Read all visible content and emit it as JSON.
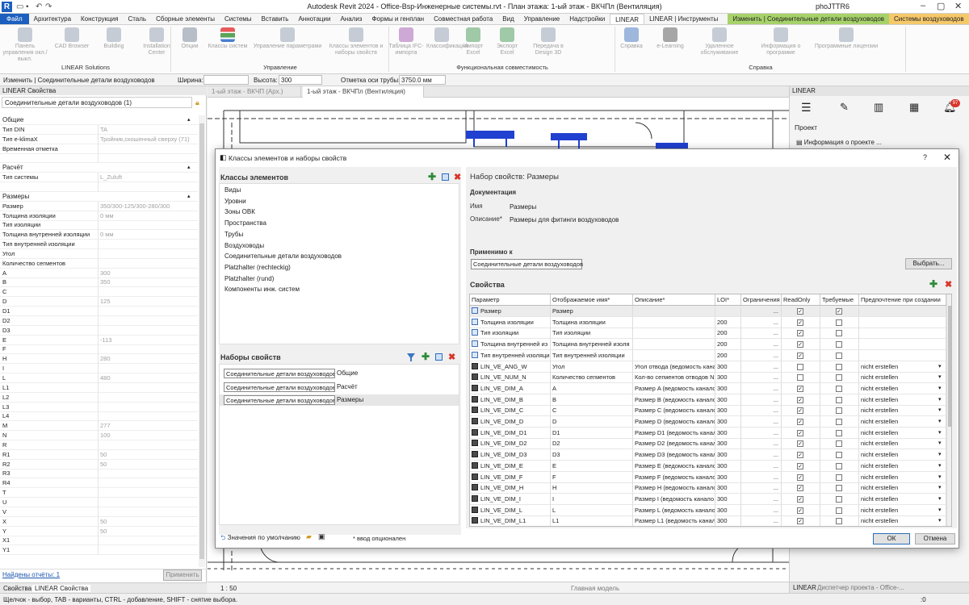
{
  "titlebar": {
    "app_title": "Autodesk Revit 2024 - Office-Bsp-Инженерные системы.rvt - План этажа: 1-ый этаж - ВКЧПл (Вентиляция)",
    "user": "phoJTTR6",
    "logo": "R"
  },
  "tabs": [
    "Файл",
    "Архитектура",
    "Конструкция",
    "Сталь",
    "Сборные элементы",
    "Системы",
    "Вставить",
    "Аннотации",
    "Анализ",
    "Формы и генплан",
    "Совместная работа",
    "Вид",
    "Управление",
    "Надстройки",
    "LINEAR",
    "LINEAR | Инструменты",
    "Изменить | Соединительные детали воздуховодов",
    "Системы воздуховодов"
  ],
  "ribbon": {
    "buttons": [
      "Панель управления окл./выкл.",
      "CAD Browser",
      "Building",
      "Installation Center",
      "Опции",
      "Классы систем",
      "Управление параметрами",
      "Классы элементов и наборы свойств",
      "Таблица IFC-импорта",
      "Классификация",
      "Импорт Excel",
      "Экспорт Excel",
      "Передача в Design 3D",
      "Справка",
      "e-Learning",
      "Удаленное обслуживание",
      "Информация о программе",
      "Программные лицензии"
    ],
    "groups": [
      "LINEAR Solutions",
      "Управление",
      "Функциональная совместимость",
      "Справка"
    ]
  },
  "optbar": {
    "modify_label": "Изменить | Соединительные детали воздуховодов",
    "width_label": "Ширина:",
    "height_label": "Высота:",
    "height_value": "300",
    "pipe_axis_label": "Отметка оси трубы:",
    "pipe_axis_value": "3750.0 мм"
  },
  "props": {
    "header": "LINEAR Свойства",
    "type_selector": "Соединительные детали воздуховодов (1)",
    "rows": [
      {
        "k": "Общие",
        "v": "",
        "sec": true
      },
      {
        "k": "Тип DIN",
        "v": "TA"
      },
      {
        "k": "Тип e-klimaX",
        "v": "Тройник,скошенный сверху (71)"
      },
      {
        "k": "Временная отметка",
        "v": ""
      },
      {
        "k": "",
        "v": ""
      },
      {
        "k": "Расчёт",
        "v": "",
        "sec": true
      },
      {
        "k": "Тип системы",
        "v": "L_Zuluft"
      },
      {
        "k": "",
        "v": ""
      },
      {
        "k": "Размеры",
        "v": "",
        "sec": true
      },
      {
        "k": "Размер",
        "v": "350/300-125/300-280/300"
      },
      {
        "k": "Толщина изоляции",
        "v": "0 мм"
      },
      {
        "k": "Тип изоляции",
        "v": ""
      },
      {
        "k": "Толщина внутренней изоляции",
        "v": "0 мм"
      },
      {
        "k": "Тип внутренней изоляции",
        "v": ""
      },
      {
        "k": "Угол",
        "v": ""
      },
      {
        "k": "Количество сегментов",
        "v": ""
      },
      {
        "k": "A",
        "v": "300"
      },
      {
        "k": "B",
        "v": "350"
      },
      {
        "k": "C",
        "v": ""
      },
      {
        "k": "D",
        "v": "125"
      },
      {
        "k": "D1",
        "v": ""
      },
      {
        "k": "D2",
        "v": ""
      },
      {
        "k": "D3",
        "v": ""
      },
      {
        "k": "E",
        "v": "-113"
      },
      {
        "k": "F",
        "v": ""
      },
      {
        "k": "H",
        "v": "280"
      },
      {
        "k": "I",
        "v": ""
      },
      {
        "k": "L",
        "v": "480"
      },
      {
        "k": "L1",
        "v": ""
      },
      {
        "k": "L2",
        "v": ""
      },
      {
        "k": "L3",
        "v": ""
      },
      {
        "k": "L4",
        "v": ""
      },
      {
        "k": "M",
        "v": "277"
      },
      {
        "k": "N",
        "v": "100"
      },
      {
        "k": "R",
        "v": ""
      },
      {
        "k": "R1",
        "v": "50"
      },
      {
        "k": "R2",
        "v": "50"
      },
      {
        "k": "R3",
        "v": ""
      },
      {
        "k": "R4",
        "v": ""
      },
      {
        "k": "T",
        "v": ""
      },
      {
        "k": "U",
        "v": ""
      },
      {
        "k": "V",
        "v": ""
      },
      {
        "k": "X",
        "v": "50"
      },
      {
        "k": "Y",
        "v": "50"
      },
      {
        "k": "X1",
        "v": ""
      },
      {
        "k": "Y1",
        "v": ""
      }
    ],
    "found_reports": "Найдены отчёты: 1",
    "apply_button": "Применить",
    "bottom_tabs": [
      "Свойства",
      "LINEAR Свойства"
    ]
  },
  "view": {
    "tabs": [
      "1-ый этаж - ВКЧП (Арх.)",
      "1-ый этаж - ВКЧПл (Вентиляция)"
    ],
    "scale": "1 : 50",
    "main_model": "Главная модель"
  },
  "linear_panel": {
    "header": "LINEAR",
    "badge": "97",
    "section": "Проект",
    "project_info": "Информация о проекте ...",
    "bottom_tabs": [
      "LINEAR",
      "Диспетчер проекта - Office-..."
    ]
  },
  "status": {
    "hint": "Щелчок - выбор, TAB - варианты, CTRL - добавление, SHIFT - снятие выбора.",
    "zoom": ":0"
  },
  "dialog": {
    "title": "Классы элементов и наборы свойств",
    "help": "?",
    "classes_label": "Классы элементов",
    "classes": [
      "Виды",
      "Уровни",
      "Зоны ОВК",
      "Пространства",
      "Трубы",
      "Воздуховоды",
      "Соединительные детали воздуховодов",
      "Platzhalter (rechteckig)",
      "Platzhalter (rund)",
      "Компоненты инж. систем"
    ],
    "sets_label": "Наборы свойств",
    "sets": [
      {
        "class": "Соединительные детали воздуховодов",
        "name": "Общие"
      },
      {
        "class": "Соединительные детали воздуховодов",
        "name": "Расчёт"
      },
      {
        "class": "Соединительные детали воздуховодов",
        "name": "Размеры"
      }
    ],
    "defaults_label": "Значения по умолчанию",
    "optional_note": "* ввод опционален",
    "set_title": "Набор свойств: Размеры",
    "documentation_label": "Документация",
    "name_label": "Имя",
    "name_value": "Размеры",
    "desc_label": "Описание*",
    "desc_value": "Размеры для фитинги воздуховодов",
    "applies_label": "Применимо к",
    "applies_value": "Соединительные детали воздуховодов",
    "choose_button": "Выбрать...",
    "properties_label": "Свойства",
    "ok": "ОК",
    "cancel": "Отмена",
    "columns": [
      "Параметр",
      "Отображаемое имя*",
      "Описание*",
      "LOI*",
      "Ограничения",
      "ReadOnly",
      "Требуемые",
      "Предпочтение при создании"
    ],
    "rows": [
      {
        "p": "Размер",
        "d": "Размер",
        "desc": "",
        "loi": "",
        "ro": true,
        "req": true,
        "pref": "",
        "icon": "b"
      },
      {
        "p": "Толщина изоляции",
        "d": "Толщина изоляции",
        "desc": "",
        "loi": "200",
        "ro": true,
        "req": false,
        "pref": "",
        "icon": "b"
      },
      {
        "p": "Тип изоляции",
        "d": "Тип изоляции",
        "desc": "",
        "loi": "200",
        "ro": true,
        "req": false,
        "pref": "",
        "icon": "b"
      },
      {
        "p": "Толщина внутренней из",
        "d": "Толщина внутренней изоля",
        "desc": "",
        "loi": "200",
        "ro": true,
        "req": false,
        "pref": "",
        "icon": "b"
      },
      {
        "p": "Тип внутренней изоляци",
        "d": "Тип внутренней изоляции",
        "desc": "",
        "loi": "200",
        "ro": true,
        "req": false,
        "pref": "",
        "icon": "b"
      },
      {
        "p": "LIN_VE_ANG_W",
        "d": "Угол",
        "desc": "Угол отвода (ведомость кана",
        "loi": "300",
        "ro": false,
        "req": false,
        "pref": "nicht erstellen",
        "icon": "d"
      },
      {
        "p": "LIN_VE_NUM_N",
        "d": "Количество сегментов",
        "desc": "Кол-во сегментов отводов N",
        "loi": "300",
        "ro": false,
        "req": false,
        "pref": "nicht erstellen",
        "icon": "d"
      },
      {
        "p": "LIN_VE_DIM_A",
        "d": "A",
        "desc": "Размер A (ведомость канало",
        "loi": "300",
        "ro": true,
        "req": false,
        "pref": "nicht erstellen",
        "icon": "d"
      },
      {
        "p": "LIN_VE_DIM_B",
        "d": "B",
        "desc": "Размер B (ведомость канало",
        "loi": "300",
        "ro": true,
        "req": false,
        "pref": "nicht erstellen",
        "icon": "d"
      },
      {
        "p": "LIN_VE_DIM_C",
        "d": "C",
        "desc": "Размер C (ведомость канало",
        "loi": "300",
        "ro": true,
        "req": false,
        "pref": "nicht erstellen",
        "icon": "d"
      },
      {
        "p": "LIN_VE_DIM_D",
        "d": "D",
        "desc": "Размер D (ведомость канало",
        "loi": "300",
        "ro": true,
        "req": false,
        "pref": "nicht erstellen",
        "icon": "d"
      },
      {
        "p": "LIN_VE_DIM_D1",
        "d": "D1",
        "desc": "Размер D1 (ведомость канал",
        "loi": "300",
        "ro": true,
        "req": false,
        "pref": "nicht erstellen",
        "icon": "d"
      },
      {
        "p": "LIN_VE_DIM_D2",
        "d": "D2",
        "desc": "Размер D2 (ведомость канал",
        "loi": "300",
        "ro": true,
        "req": false,
        "pref": "nicht erstellen",
        "icon": "d"
      },
      {
        "p": "LIN_VE_DIM_D3",
        "d": "D3",
        "desc": "Размер D3 (ведомость канал",
        "loi": "300",
        "ro": true,
        "req": false,
        "pref": "nicht erstellen",
        "icon": "d"
      },
      {
        "p": "LIN_VE_DIM_E",
        "d": "E",
        "desc": "Размер E (ведомость канало",
        "loi": "300",
        "ro": true,
        "req": false,
        "pref": "nicht erstellen",
        "icon": "d"
      },
      {
        "p": "LIN_VE_DIM_F",
        "d": "F",
        "desc": "Размер F (ведомость канало",
        "loi": "300",
        "ro": true,
        "req": false,
        "pref": "nicht erstellen",
        "icon": "d"
      },
      {
        "p": "LIN_VE_DIM_H",
        "d": "H",
        "desc": "Размер H (ведомость канало",
        "loi": "300",
        "ro": true,
        "req": false,
        "pref": "nicht erstellen",
        "icon": "d"
      },
      {
        "p": "LIN_VE_DIM_I",
        "d": "I",
        "desc": "Размер I (ведомость канало",
        "loi": "300",
        "ro": true,
        "req": false,
        "pref": "nicht erstellen",
        "icon": "d"
      },
      {
        "p": "LIN_VE_DIM_L",
        "d": "L",
        "desc": "Размер L (ведомость канало",
        "loi": "300",
        "ro": true,
        "req": false,
        "pref": "nicht erstellen",
        "icon": "d"
      },
      {
        "p": "LIN_VE_DIM_L1",
        "d": "L1",
        "desc": "Размер L1 (ведомость канал",
        "loi": "300",
        "ro": true,
        "req": false,
        "pref": "nicht erstellen",
        "icon": "d"
      }
    ]
  }
}
